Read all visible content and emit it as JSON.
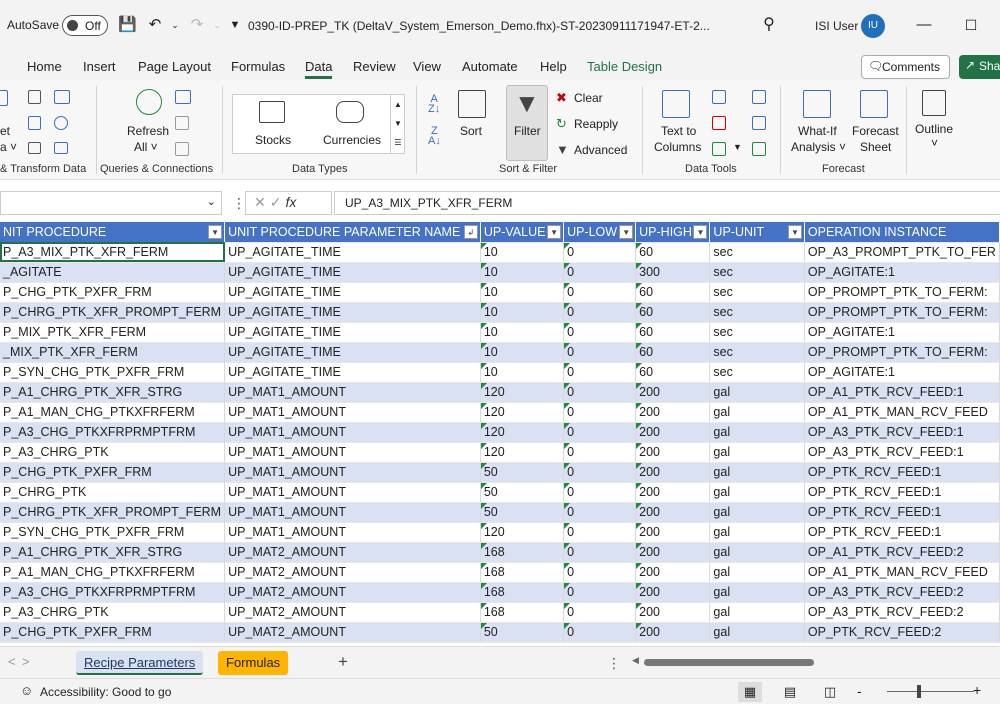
{
  "titlebar": {
    "autosave_label": "AutoSave",
    "autosave_state": "Off",
    "filename": "0390-ID-PREP_TK (DeltaV_System_Emerson_Demo.fhx)-ST-20230911171947-ET-2...",
    "user_name": "ISI User",
    "user_initials": "IU"
  },
  "menu": {
    "tabs": [
      "Home",
      "Insert",
      "Page Layout",
      "Formulas",
      "Data",
      "Review",
      "View",
      "Automate",
      "Help",
      "Table Design"
    ],
    "active": "Data",
    "comments_label": "Comments",
    "share_label": "Sha"
  },
  "ribbon": {
    "get_transform_label": "& Transform Data",
    "get_partial_left1": "et",
    "get_partial_left2": "a ˅",
    "refresh_label": "Refresh",
    "refresh_all_label": "All ˅",
    "queries_label": "Queries & Connections",
    "stocks_label": "Stocks",
    "currencies_label": "Currencies",
    "data_types_label": "Data Types",
    "sort_label": "Sort",
    "filter_label": "Filter",
    "clear_label": "Clear",
    "reapply_label": "Reapply",
    "advanced_label": "Advanced",
    "sort_filter_label": "Sort & Filter",
    "text_to_columns_label1": "Text to",
    "text_to_columns_label2": "Columns",
    "data_tools_label": "Data Tools",
    "whatif_label1": "What-If",
    "whatif_label2": "Analysis ˅",
    "forecast_label1": "Forecast",
    "forecast_label2": "Sheet",
    "forecast_group_label": "Forecast",
    "outline_label": "Outline",
    "outline_caret": "˅"
  },
  "formula_bar": {
    "name_box": "",
    "formula": "UP_A3_MIX_PTK_XFR_FERM",
    "fx_label": "fx"
  },
  "table": {
    "headers": [
      "NIT PROCEDURE",
      "UNIT PROCEDURE PARAMETER NAME",
      "UP-VALUE",
      "UP-LOW",
      "UP-HIGH",
      "UP-UNIT",
      "OPERATION INSTANCE"
    ],
    "rows": [
      [
        "P_A3_MIX_PTK_XFR_FERM",
        "UP_AGITATE_TIME",
        "10",
        "0",
        "60",
        "sec",
        "OP_A3_PROMPT_PTK_TO_FER"
      ],
      [
        "_AGITATE",
        "UP_AGITATE_TIME",
        "10",
        "0",
        "300",
        "sec",
        "OP_AGITATE:1"
      ],
      [
        "P_CHG_PTK_PXFR_FRM",
        "UP_AGITATE_TIME",
        "10",
        "0",
        "60",
        "sec",
        "OP_PROMPT_PTK_TO_FERM:"
      ],
      [
        "P_CHRG_PTK_XFR_PROMPT_FERM",
        "UP_AGITATE_TIME",
        "10",
        "0",
        "60",
        "sec",
        "OP_PROMPT_PTK_TO_FERM:"
      ],
      [
        "P_MIX_PTK_XFR_FERM",
        "UP_AGITATE_TIME",
        "10",
        "0",
        "60",
        "sec",
        "OP_AGITATE:1"
      ],
      [
        "_MIX_PTK_XFR_FERM",
        "UP_AGITATE_TIME",
        "10",
        "0",
        "60",
        "sec",
        "OP_PROMPT_PTK_TO_FERM:"
      ],
      [
        "P_SYN_CHG_PTK_PXFR_FRM",
        "UP_AGITATE_TIME",
        "10",
        "0",
        "60",
        "sec",
        "OP_AGITATE:1"
      ],
      [
        "P_A1_CHRG_PTK_XFR_STRG",
        "UP_MAT1_AMOUNT",
        "120",
        "0",
        "200",
        "gal",
        "OP_A1_PTK_RCV_FEED:1"
      ],
      [
        "P_A1_MAN_CHG_PTKXFRFERM",
        "UP_MAT1_AMOUNT",
        "120",
        "0",
        "200",
        "gal",
        "OP_A1_PTK_MAN_RCV_FEED"
      ],
      [
        "P_A3_CHG_PTKXFRPRMPTFRM",
        "UP_MAT1_AMOUNT",
        "120",
        "0",
        "200",
        "gal",
        "OP_A3_PTK_RCV_FEED:1"
      ],
      [
        "P_A3_CHRG_PTK",
        "UP_MAT1_AMOUNT",
        "120",
        "0",
        "200",
        "gal",
        "OP_A3_PTK_RCV_FEED:1"
      ],
      [
        "P_CHG_PTK_PXFR_FRM",
        "UP_MAT1_AMOUNT",
        "50",
        "0",
        "200",
        "gal",
        "OP_PTK_RCV_FEED:1"
      ],
      [
        "P_CHRG_PTK",
        "UP_MAT1_AMOUNT",
        "50",
        "0",
        "200",
        "gal",
        "OP_PTK_RCV_FEED:1"
      ],
      [
        "P_CHRG_PTK_XFR_PROMPT_FERM",
        "UP_MAT1_AMOUNT",
        "50",
        "0",
        "200",
        "gal",
        "OP_PTK_RCV_FEED:1"
      ],
      [
        "P_SYN_CHG_PTK_PXFR_FRM",
        "UP_MAT1_AMOUNT",
        "120",
        "0",
        "200",
        "gal",
        "OP_PTK_RCV_FEED:1"
      ],
      [
        "P_A1_CHRG_PTK_XFR_STRG",
        "UP_MAT2_AMOUNT",
        "168",
        "0",
        "200",
        "gal",
        "OP_A1_PTK_RCV_FEED:2"
      ],
      [
        "P_A1_MAN_CHG_PTKXFRFERM",
        "UP_MAT2_AMOUNT",
        "168",
        "0",
        "200",
        "gal",
        "OP_A1_PTK_MAN_RCV_FEED"
      ],
      [
        "P_A3_CHG_PTKXFRPRMPTFRM",
        "UP_MAT2_AMOUNT",
        "168",
        "0",
        "200",
        "gal",
        "OP_A3_PTK_RCV_FEED:2"
      ],
      [
        "P_A3_CHRG_PTK",
        "UP_MAT2_AMOUNT",
        "168",
        "0",
        "200",
        "gal",
        "OP_A3_PTK_RCV_FEED:2"
      ],
      [
        "P_CHG_PTK_PXFR_FRM",
        "UP_MAT2_AMOUNT",
        "50",
        "0",
        "200",
        "gal",
        "OP_PTK_RCV_FEED:2"
      ]
    ]
  },
  "sheets": {
    "tabs": [
      "Recipe Parameters",
      "Formulas"
    ],
    "active": "Recipe Parameters",
    "add_label": "+"
  },
  "status": {
    "accessibility": "Accessibility: Good to go",
    "zoom_minus": "-",
    "zoom_plus": "+"
  },
  "colors": {
    "accent": "#217346",
    "header_blue": "#4472c4",
    "band": "#d9e1f2",
    "formulas_tab": "#ffb400"
  }
}
